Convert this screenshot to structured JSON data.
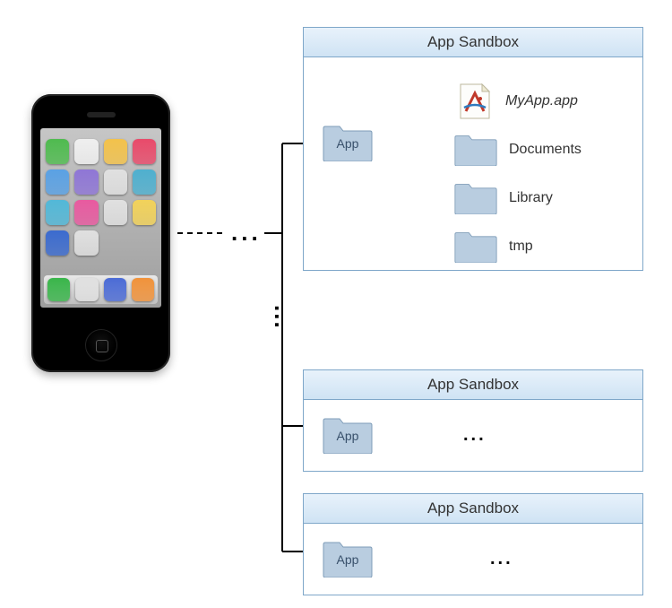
{
  "sandbox_title": "App Sandbox",
  "app_folder_label": "App",
  "tree_items": [
    {
      "kind": "file",
      "label": "MyApp.app",
      "italic": true
    },
    {
      "kind": "folder",
      "label": "Documents"
    },
    {
      "kind": "folder",
      "label": "Library"
    },
    {
      "kind": "folder",
      "label": "tmp"
    }
  ],
  "ellipsis": "...",
  "phone_icon_colors": [
    "#4fbb4f",
    "#efefef",
    "#f3c24b",
    "#e94a6a",
    "#5aa1e4",
    "#8f76d6",
    "#e0e0e0",
    "#4fb0cf",
    "#52b8d8",
    "#e85aa0",
    "#e0e0e0",
    "#f2d25a",
    "#3b6bcf",
    "#e0e0e0",
    "",
    ""
  ],
  "dock_icon_colors": [
    "#39b54a",
    "#e0e0e0",
    "#4b6bd6",
    "#f0923a"
  ]
}
